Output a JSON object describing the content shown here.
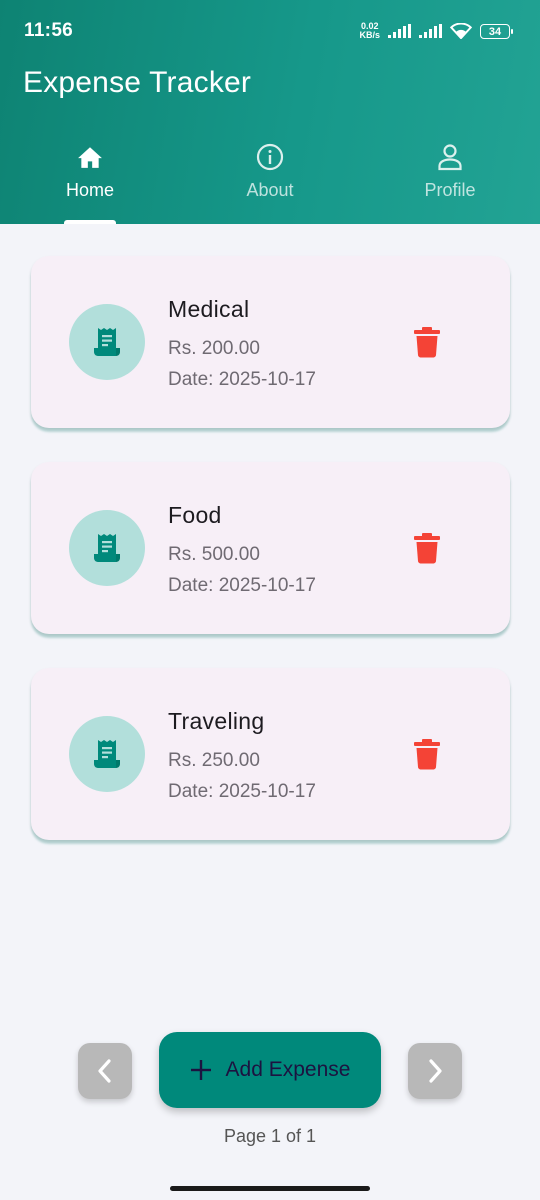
{
  "status_bar": {
    "time": "11:56",
    "speed_value": "0.02",
    "speed_unit": "KB/s",
    "battery": "34"
  },
  "app_bar": {
    "title": "Expense Tracker"
  },
  "tabs": [
    {
      "label": "Home",
      "icon": "home-icon",
      "active": true
    },
    {
      "label": "About",
      "icon": "info-icon",
      "active": false
    },
    {
      "label": "Profile",
      "icon": "person-icon",
      "active": false
    }
  ],
  "expenses": [
    {
      "name": "Medical",
      "amount": "Rs. 200.00",
      "date": "Date: 2025-10-17",
      "icon": "receipt-icon"
    },
    {
      "name": "Food",
      "amount": "Rs. 500.00",
      "date": "Date: 2025-10-17",
      "icon": "receipt-icon"
    },
    {
      "name": "Traveling",
      "amount": "Rs. 250.00",
      "date": "Date: 2025-10-17",
      "icon": "receipt-icon"
    }
  ],
  "fab": {
    "label": "Add Expense",
    "icon": "plus-icon"
  },
  "pagination": {
    "text": "Page 1 of 1"
  },
  "colors": {
    "primary": "#00897b",
    "header_start": "#0e8373",
    "header_end": "#22a394",
    "card_bg": "#f7eff7",
    "icon_circle": "#b2dfdb",
    "delete": "#f44336"
  }
}
